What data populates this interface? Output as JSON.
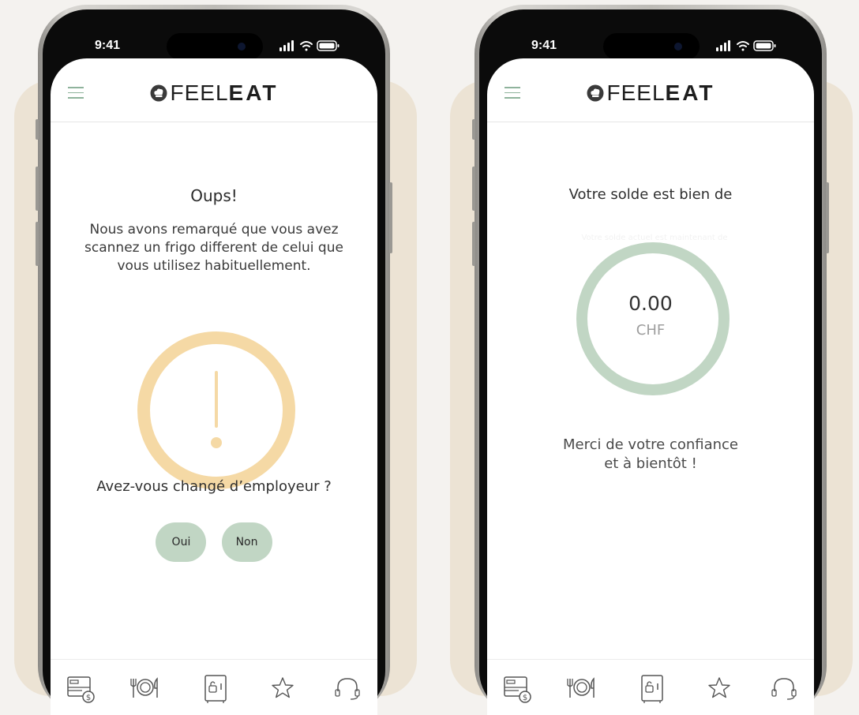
{
  "colors": {
    "backdrop": "#ece3d4",
    "accent_green": "#c1d6c4",
    "warning_ring": "#f5d9a5",
    "icon_green": "#8fb39c"
  },
  "screens": [
    {
      "status_time": "9:41",
      "brand": {
        "light": "FEEL",
        "bold": "EAT"
      },
      "title": "Oups!",
      "message": "Nous avons remarqué que vous avez scannez un frigo different de celui que vous utilisez  habituellement.",
      "question": "Avez-vous changé d’employeur ?",
      "buttons": {
        "yes": "Oui",
        "no": "Non"
      },
      "warning_icon": "exclamation-circle-icon"
    },
    {
      "status_time": "9:41",
      "brand": {
        "light": "FEEL",
        "bold": "EAT"
      },
      "title": "Votre solde est bien de",
      "ghost_text": "Votre solde actuel est maintenant de",
      "balance": "0.00",
      "currency": "CHF",
      "thanks_line1": "Merci de votre confiance",
      "thanks_line2": "et à bientôt !"
    }
  ],
  "tabbar": [
    {
      "icon": "card-dollar-icon"
    },
    {
      "icon": "fork-plate-knife-icon"
    },
    {
      "icon": "fridge-lock-icon"
    },
    {
      "icon": "star-icon"
    },
    {
      "icon": "headset-icon"
    }
  ]
}
